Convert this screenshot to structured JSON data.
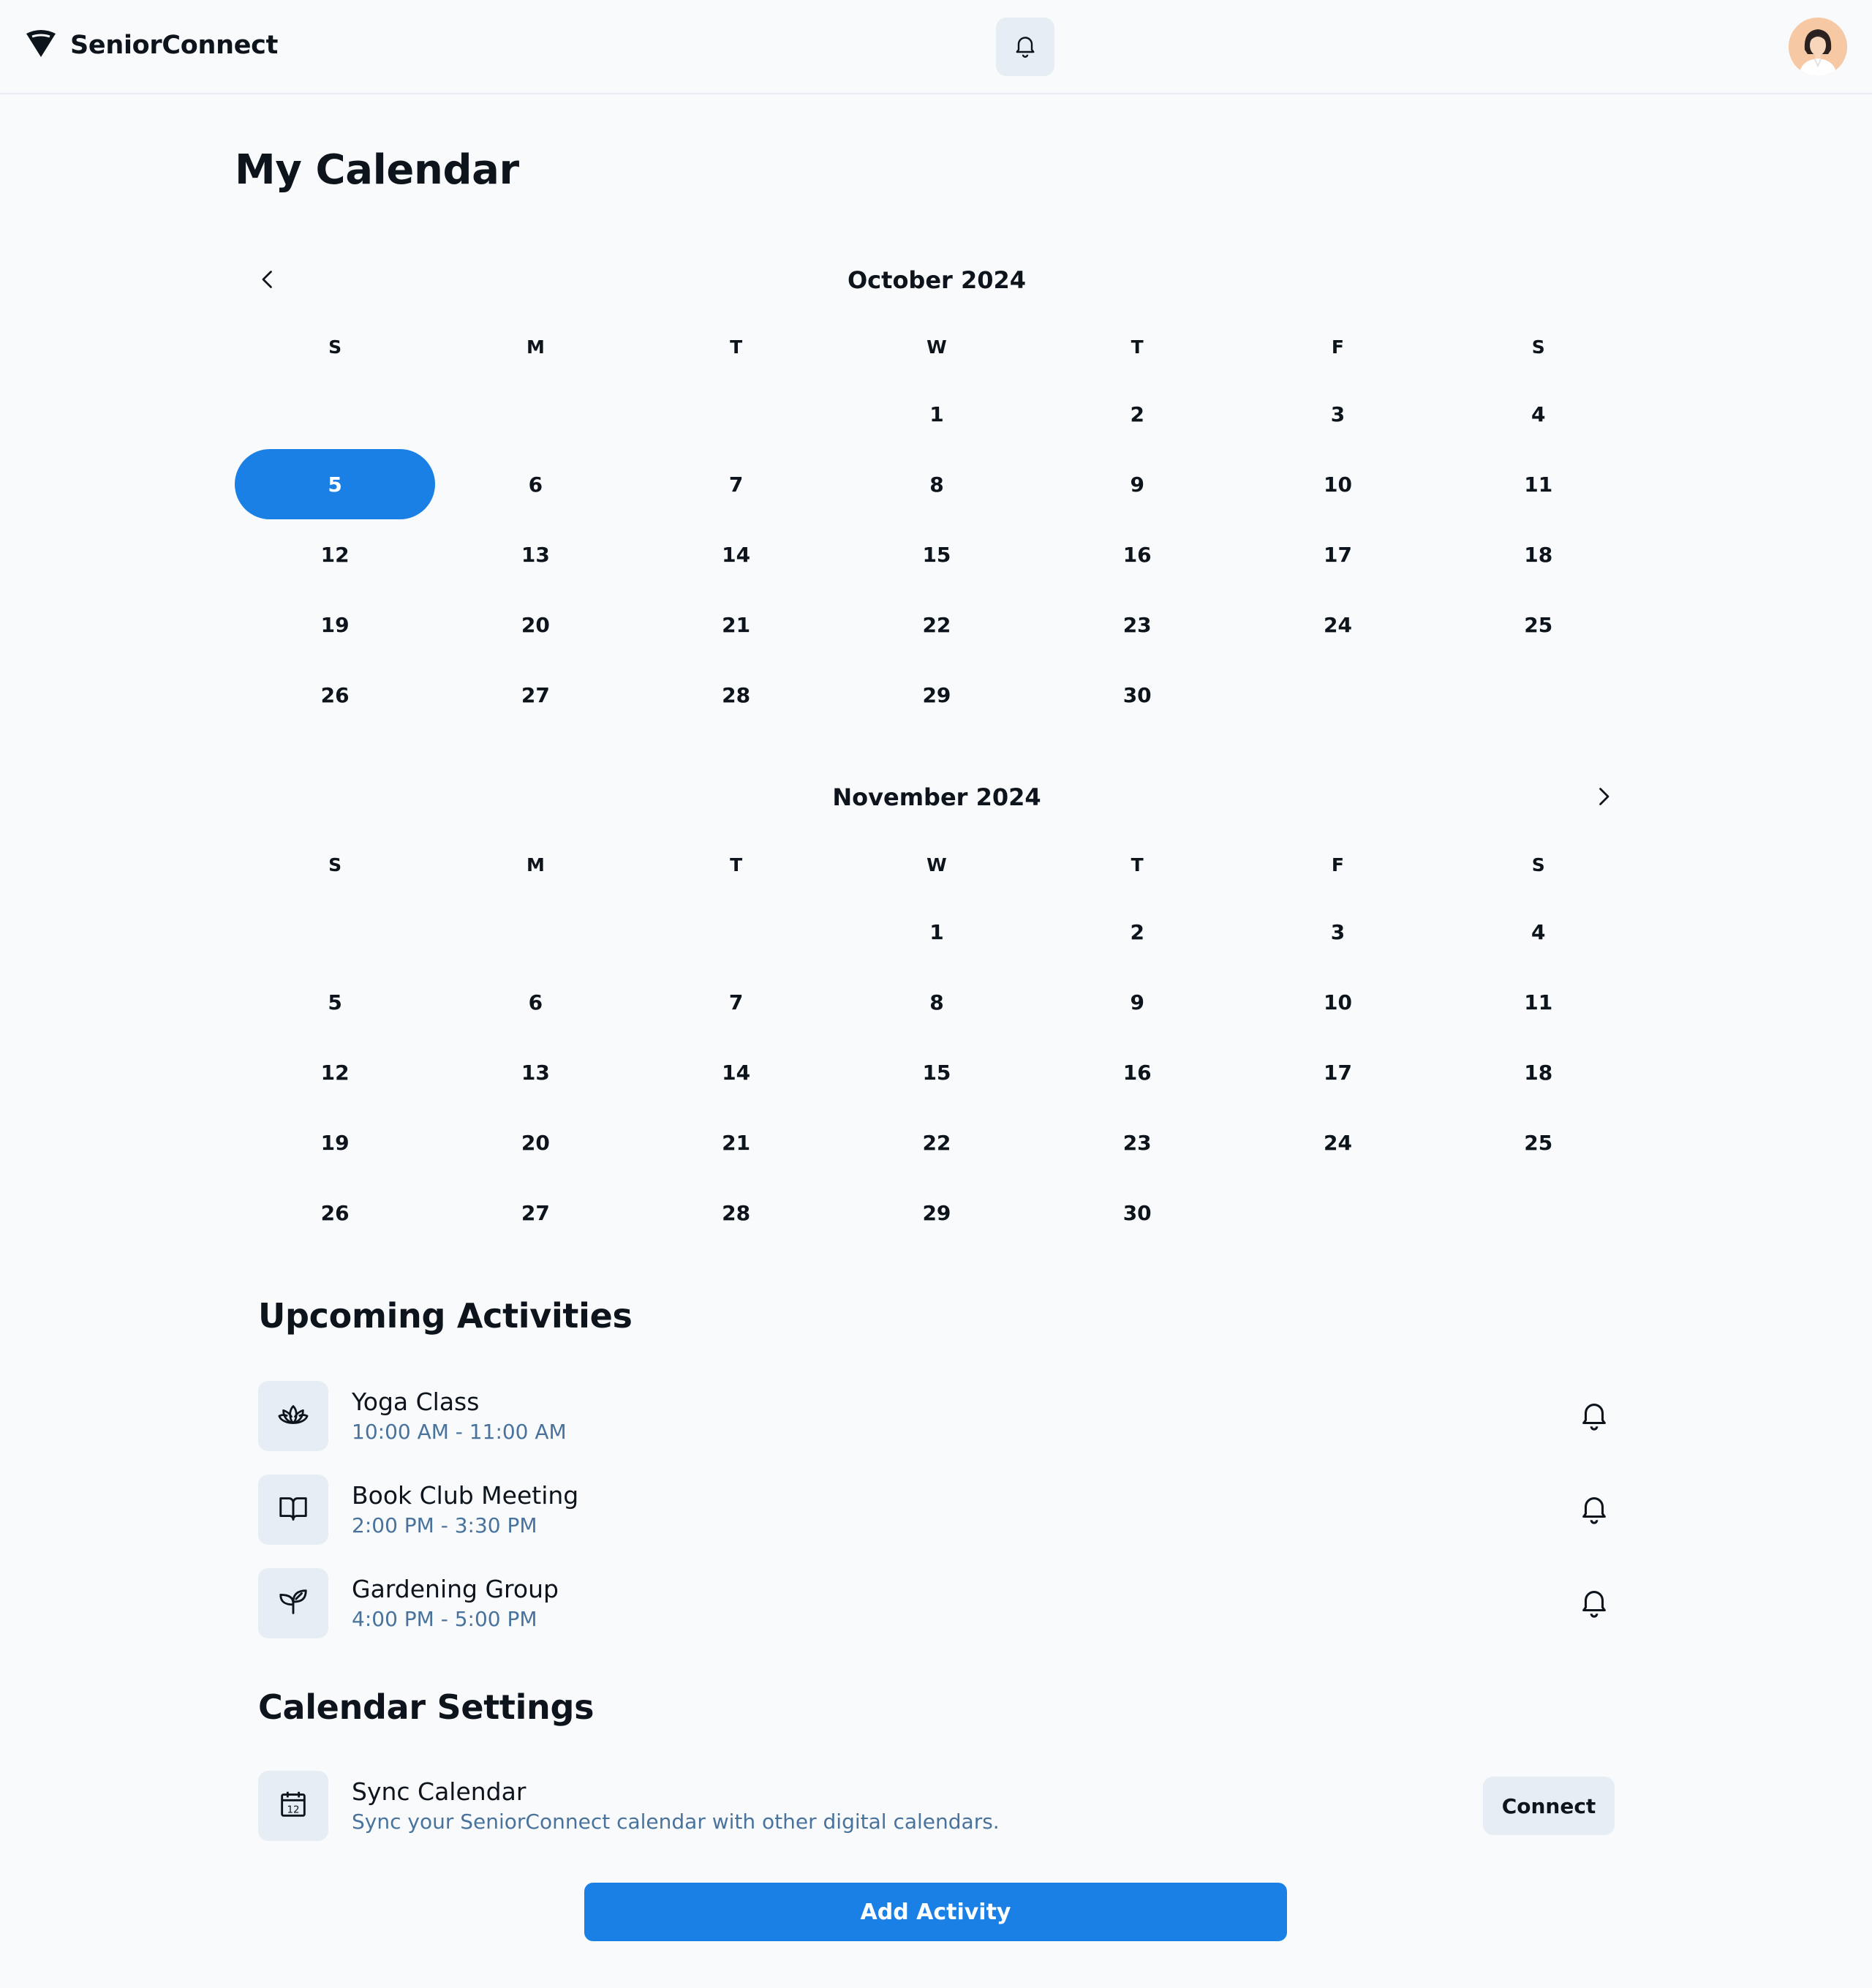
{
  "header": {
    "brand": "SeniorConnect",
    "icons": {
      "logo": "brand-logo-icon",
      "notifications": "bell-icon",
      "avatar": "user-avatar"
    }
  },
  "page": {
    "title": "My Calendar"
  },
  "calendar": {
    "weekday_labels": [
      "S",
      "M",
      "T",
      "W",
      "T",
      "F",
      "S"
    ],
    "selected": {
      "month": "October 2024",
      "day": "5"
    },
    "accent_color": "#1a80e5",
    "months": [
      {
        "title": "October 2024",
        "weeks": [
          [
            "",
            "",
            "",
            "1",
            "2",
            "3",
            "4"
          ],
          [
            "5",
            "6",
            "7",
            "8",
            "9",
            "10",
            "11"
          ],
          [
            "12",
            "13",
            "14",
            "15",
            "16",
            "17",
            "18"
          ],
          [
            "19",
            "20",
            "21",
            "22",
            "23",
            "24",
            "25"
          ],
          [
            "26",
            "27",
            "28",
            "29",
            "30",
            "",
            ""
          ]
        ]
      },
      {
        "title": "November 2024",
        "weeks": [
          [
            "",
            "",
            "",
            "1",
            "2",
            "3",
            "4"
          ],
          [
            "5",
            "6",
            "7",
            "8",
            "9",
            "10",
            "11"
          ],
          [
            "12",
            "13",
            "14",
            "15",
            "16",
            "17",
            "18"
          ],
          [
            "19",
            "20",
            "21",
            "22",
            "23",
            "24",
            "25"
          ],
          [
            "26",
            "27",
            "28",
            "29",
            "30",
            "",
            ""
          ]
        ]
      }
    ]
  },
  "activities": {
    "title": "Upcoming Activities",
    "items": [
      {
        "title": "Yoga Class",
        "time": "10:00 AM - 11:00 AM",
        "icon": "lotus-icon"
      },
      {
        "title": "Book Club Meeting",
        "time": "2:00 PM - 3:30 PM",
        "icon": "book-icon"
      },
      {
        "title": "Gardening Group",
        "time": "4:00 PM - 5:00 PM",
        "icon": "plant-icon"
      }
    ]
  },
  "settings": {
    "title": "Calendar Settings",
    "sync": {
      "title": "Sync Calendar",
      "description": "Sync your SeniorConnect calendar with other digital calendars.",
      "button": "Connect",
      "icon": "calendar-icon"
    }
  },
  "actions": {
    "add_activity": "Add Activity"
  }
}
